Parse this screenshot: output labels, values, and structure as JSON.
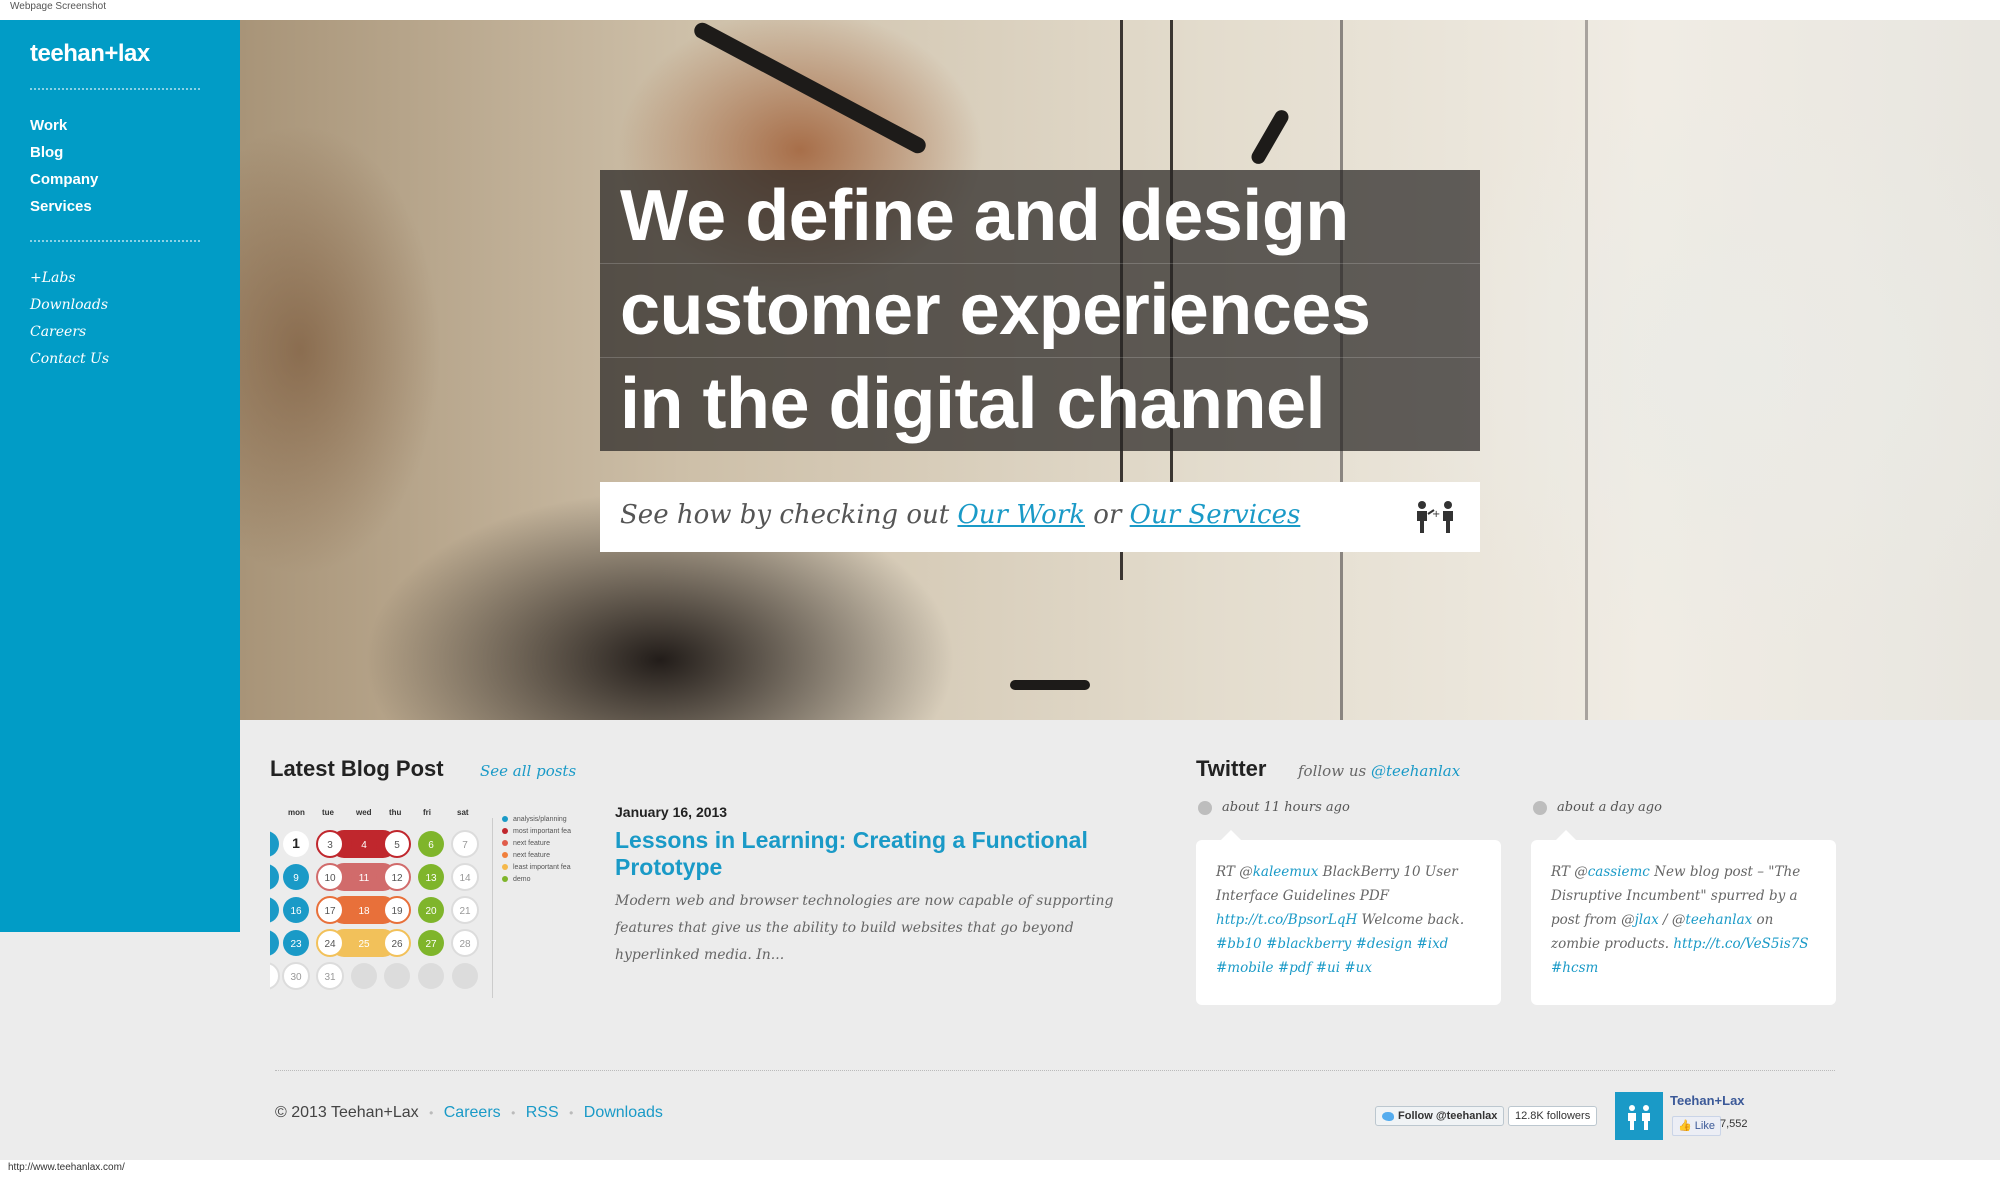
{
  "window": {
    "title": "Webpage Screenshot",
    "status_url": "http://www.teehanlax.com/"
  },
  "sidebar": {
    "logo": "teehan+lax",
    "main_nav": [
      "Work",
      "Blog",
      "Company",
      "Services"
    ],
    "secondary_nav": [
      "+Labs",
      "Downloads",
      "Careers",
      "Contact Us"
    ]
  },
  "hero": {
    "headline_lines": [
      "We define and design",
      "customer experiences",
      "in the digital channel"
    ],
    "cta_prefix": "See how by checking out",
    "cta_link1": "Our Work",
    "cta_or": "or",
    "cta_link2": "Our Services"
  },
  "blog": {
    "heading": "Latest Blog Post",
    "see_all": "See all posts",
    "calendar": {
      "days": [
        "mon",
        "tue",
        "wed",
        "thu",
        "fri",
        "sat"
      ],
      "legend": [
        "analysis/planning",
        "most important fea",
        "next feature",
        "next feature",
        "least important fea",
        "demo"
      ],
      "legend_colors": [
        "#1a9ac7",
        "#c0272d",
        "#e05c4a",
        "#f07f3c",
        "#f5b84a",
        "#7fb52b"
      ],
      "weeks": [
        [
          [
            "",
            "edge-blue"
          ],
          [
            "1",
            "plain"
          ],
          [
            "3",
            "red-ring"
          ],
          [
            "4",
            "red"
          ],
          [
            "5",
            "red-ring"
          ],
          [
            "6",
            "green"
          ],
          [
            "7",
            "grey-ring"
          ]
        ],
        [
          [
            "",
            "edge-blue"
          ],
          [
            "9",
            "blue"
          ],
          [
            "10",
            "rose-ring"
          ],
          [
            "11",
            "rose"
          ],
          [
            "12",
            "rose-ring"
          ],
          [
            "13",
            "green"
          ],
          [
            "14",
            "grey-ring"
          ]
        ],
        [
          [
            "",
            "edge-blue"
          ],
          [
            "16",
            "blue"
          ],
          [
            "17",
            "orange-ring"
          ],
          [
            "18",
            "orange"
          ],
          [
            "19",
            "orange-ring"
          ],
          [
            "20",
            "green"
          ],
          [
            "21",
            "grey-ring"
          ]
        ],
        [
          [
            "",
            "edge-blue"
          ],
          [
            "23",
            "blue"
          ],
          [
            "24",
            "yellow-ring"
          ],
          [
            "25",
            "yellow"
          ],
          [
            "26",
            "yellow-ring"
          ],
          [
            "27",
            "green"
          ],
          [
            "28",
            "grey-ring"
          ]
        ],
        [
          [
            "",
            "edge-white"
          ],
          [
            "30",
            "grey-ring"
          ],
          [
            "31",
            "grey-ring"
          ],
          [
            "",
            "grey"
          ],
          [
            "",
            "grey"
          ],
          [
            "",
            "grey"
          ],
          [
            "",
            "grey"
          ]
        ]
      ]
    },
    "post_date": "January 16, 2013",
    "post_title": "Lessons in Learning: Creating a Functional Prototype",
    "post_excerpt": "Modern web and browser technologies are now capable of supporting features that give us the ability to build websites that go beyond hyperlinked media. In..."
  },
  "twitter": {
    "heading": "Twitter",
    "follow_prefix": "follow us",
    "handle": "@teehanlax",
    "tweets": [
      {
        "time": "about 11 hours ago",
        "parts": [
          [
            "RT @",
            false
          ],
          [
            "kaleemux",
            true
          ],
          [
            " BlackBerry 10 User Interface Guidelines PDF ",
            false
          ],
          [
            "http://t.co/BpsorLqH",
            true
          ],
          [
            " Welcome back. ",
            false
          ],
          [
            "#bb10",
            true
          ],
          [
            " ",
            false
          ],
          [
            "#blackberry",
            true
          ],
          [
            " ",
            false
          ],
          [
            "#design",
            true
          ],
          [
            " ",
            false
          ],
          [
            "#ixd",
            true
          ],
          [
            " ",
            false
          ],
          [
            "#mobile",
            true
          ],
          [
            " ",
            false
          ],
          [
            "#pdf",
            true
          ],
          [
            " ",
            false
          ],
          [
            "#ui",
            true
          ],
          [
            " ",
            false
          ],
          [
            "#ux",
            true
          ]
        ]
      },
      {
        "time": "about a day ago",
        "parts": [
          [
            "RT @",
            false
          ],
          [
            "cassiemc",
            true
          ],
          [
            " New blog post – \"The Disruptive Incumbent\" spurred by a post from @",
            false
          ],
          [
            "jlax",
            true
          ],
          [
            " / @",
            false
          ],
          [
            "teehanlax",
            true
          ],
          [
            " on zombie products. ",
            false
          ],
          [
            "http://t.co/VeS5is7S",
            true
          ],
          [
            " ",
            false
          ],
          [
            "#hcsm",
            true
          ]
        ]
      }
    ]
  },
  "footer": {
    "copyright": "© 2013 Teehan+Lax",
    "links": [
      "Careers",
      "RSS",
      "Downloads"
    ],
    "follow_button": "Follow @teehanlax",
    "followers": "12.8K followers",
    "fb_name": "Teehan+Lax",
    "fb_like": "Like",
    "fb_count": "7,552"
  },
  "colors": {
    "sidebar": "#019cc6",
    "link": "#1a9ac7",
    "background": "#ececec"
  }
}
